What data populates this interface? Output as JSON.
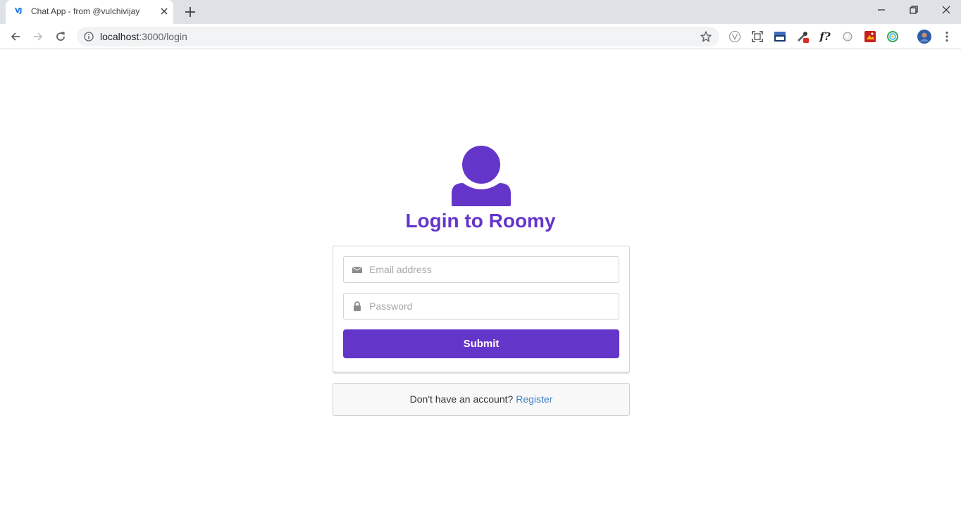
{
  "browser": {
    "tab": {
      "favicon_text": "VJ",
      "title": "Chat App - from @vulchivijay"
    },
    "url": {
      "host": "localhost",
      "rest": ":3000/login"
    },
    "extensions": [
      "vivaldi-icon",
      "screenshot-icon",
      "new-icon",
      "eyedropper-icon",
      "font-icon",
      "circle-icon",
      "image-icon",
      "color-icon",
      "profile-avatar"
    ],
    "extension_font_label": "f?"
  },
  "page": {
    "title": "Login to Roomy",
    "email_placeholder": "Email address",
    "password_placeholder": "Password",
    "submit_label": "Submit",
    "message_text": "Don't have an account?",
    "register_label": "Register"
  },
  "colors": {
    "accent": "#6435c9",
    "link": "#4183c4"
  }
}
